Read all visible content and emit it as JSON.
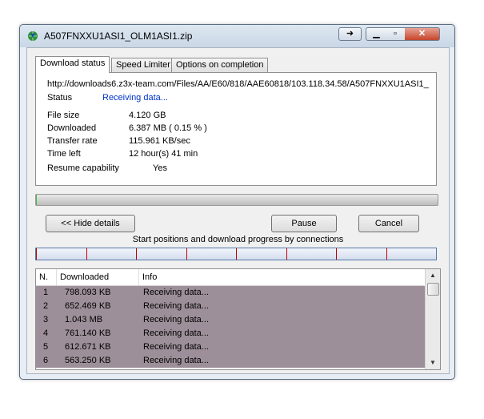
{
  "window": {
    "title": "A507FNXXU1ASI1_OLM1ASI1.zip",
    "app_icon": "idm-globe-icon"
  },
  "tabs": [
    {
      "label": "Download status",
      "active": true
    },
    {
      "label": "Speed Limiter",
      "active": false
    },
    {
      "label": "Options on completion",
      "active": false
    }
  ],
  "status": {
    "url": "http://downloads6.z3x-team.com/Files/AA/E60/818/AAE60818/103.118.34.58/A507FNXXU1ASI1_",
    "status_label": "Status",
    "status_value": "Receiving data...",
    "file_size_label": "File size",
    "file_size_value": "4.120  GB",
    "downloaded_label": "Downloaded",
    "downloaded_value": "6.387  MB  ( 0.15 % )",
    "transfer_rate_label": "Transfer rate",
    "transfer_rate_value": "115.961  KB/sec",
    "time_left_label": "Time left",
    "time_left_value": "12 hour(s) 41 min",
    "resume_label": "Resume capability",
    "resume_value": "Yes"
  },
  "progress": {
    "fraction": 0.0015
  },
  "buttons": {
    "hide_details": "<< Hide details",
    "pause": "Pause",
    "cancel": "Cancel"
  },
  "connections": {
    "caption": "Start positions and download progress by connections",
    "count": 8
  },
  "list": {
    "headers": {
      "n": "N.",
      "downloaded": "Downloaded",
      "info": "Info"
    },
    "rows": [
      {
        "n": "1",
        "downloaded": "798.093  KB",
        "info": "Receiving data..."
      },
      {
        "n": "2",
        "downloaded": "652.469  KB",
        "info": "Receiving data..."
      },
      {
        "n": "3",
        "downloaded": "1.043  MB",
        "info": "Receiving data..."
      },
      {
        "n": "4",
        "downloaded": "761.140  KB",
        "info": "Receiving data..."
      },
      {
        "n": "5",
        "downloaded": "612.671  KB",
        "info": "Receiving data..."
      },
      {
        "n": "6",
        "downloaded": "563.250  KB",
        "info": "Receiving data..."
      }
    ]
  },
  "colors": {
    "status_text": "#0033cc",
    "row_bg": "#9d8f99",
    "conn_marker": "#c00000"
  }
}
